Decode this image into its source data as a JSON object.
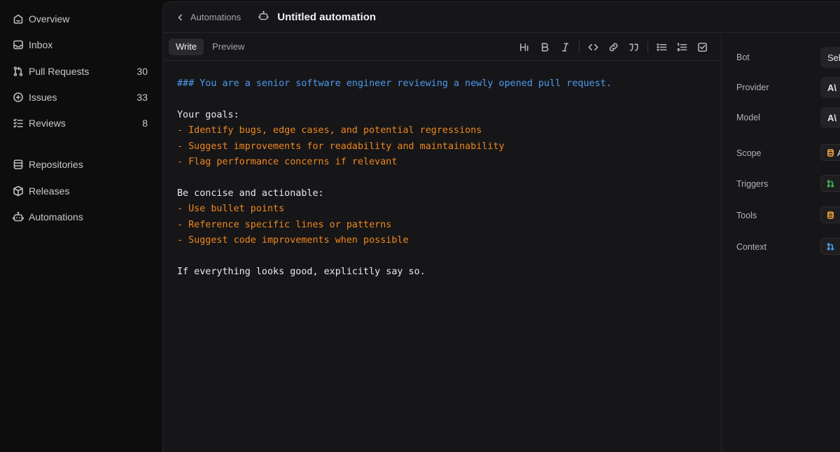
{
  "sidebar": {
    "items": [
      {
        "label": "Overview",
        "icon": "home-icon",
        "count": ""
      },
      {
        "label": "Inbox",
        "icon": "inbox-icon",
        "count": ""
      },
      {
        "label": "Pull Requests",
        "icon": "pull-request-icon",
        "count": "30"
      },
      {
        "label": "Issues",
        "icon": "issue-icon",
        "count": "33"
      },
      {
        "label": "Reviews",
        "icon": "reviews-icon",
        "count": "8"
      },
      {
        "label": "Repositories",
        "icon": "repositories-icon",
        "count": ""
      },
      {
        "label": "Releases",
        "icon": "releases-icon",
        "count": ""
      },
      {
        "label": "Automations",
        "icon": "bot-icon",
        "count": ""
      }
    ]
  },
  "header": {
    "back_label": "Automations",
    "title": "Untitled automation"
  },
  "editor": {
    "tabs": [
      {
        "label": "Write",
        "active": true
      },
      {
        "label": "Preview",
        "active": false
      }
    ],
    "tools": [
      "heading-icon",
      "bold-icon",
      "italic-icon",
      "code-icon",
      "link-icon",
      "quote-icon",
      "bullet-list-icon",
      "numbered-list-icon",
      "task-list-icon"
    ],
    "lines": [
      {
        "text": "### You are a senior software engineer reviewing a newly opened pull request.",
        "kind": "heading"
      },
      {
        "text": "",
        "kind": "text"
      },
      {
        "text": "Your goals:",
        "kind": "text"
      },
      {
        "text": "- Identify bugs, edge cases, and potential regressions",
        "kind": "bullet"
      },
      {
        "text": "- Suggest improvements for readability and maintainability",
        "kind": "bullet"
      },
      {
        "text": "- Flag performance concerns if relevant",
        "kind": "bullet"
      },
      {
        "text": "",
        "kind": "text"
      },
      {
        "text": "Be concise and actionable:",
        "kind": "text"
      },
      {
        "text": "- Use bullet points",
        "kind": "bullet"
      },
      {
        "text": "- Reference specific lines or patterns",
        "kind": "bullet"
      },
      {
        "text": "- Suggest code improvements when possible",
        "kind": "bullet"
      },
      {
        "text": "",
        "kind": "text"
      },
      {
        "text": "If everything looks good, explicitly say so.",
        "kind": "text"
      }
    ],
    "colors": {
      "heading": "#4d9bf0",
      "bullet": "#f0871e",
      "text": "#eaeaec"
    }
  },
  "properties": {
    "bot": {
      "label": "Bot",
      "value": "Sel"
    },
    "provider": {
      "label": "Provider",
      "value": "A\\"
    },
    "model": {
      "label": "Model",
      "value": "A\\"
    },
    "scope": {
      "label": "Scope",
      "value": "A",
      "icon": "database-icon",
      "icon_color": "#e8a13a"
    },
    "triggers": {
      "label": "Triggers",
      "value": "",
      "icon": "pull-request-icon",
      "icon_color": "#3fb950"
    },
    "tools": {
      "label": "Tools",
      "value": "",
      "icon": "database-icon",
      "icon_color": "#e8a13a"
    },
    "context": {
      "label": "Context",
      "value": "",
      "icon": "pull-request-icon",
      "icon_color": "#4d9bf0"
    }
  }
}
